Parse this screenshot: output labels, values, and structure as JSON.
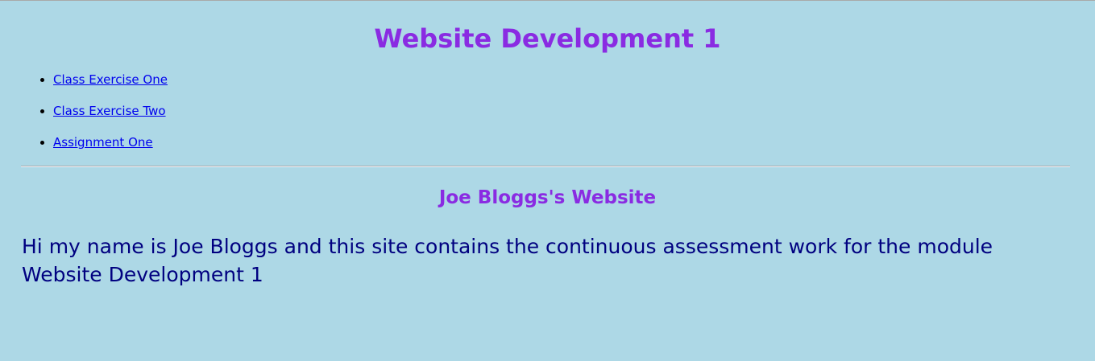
{
  "header": {
    "title": "Website Development 1"
  },
  "nav": {
    "items": [
      {
        "label": "Class Exercise One"
      },
      {
        "label": "Class Exercise Two"
      },
      {
        "label": "Assignment One"
      }
    ]
  },
  "content": {
    "heading": "Joe Bloggs's Website",
    "paragraph": "Hi my name is Joe Bloggs and this site contains the continuous assessment work for the module Website Development 1"
  },
  "colors": {
    "background": "#add8e6",
    "heading": "#8a2be2",
    "link": "#0000ee",
    "body_text": "#000080",
    "divider": "#a9a9a9"
  }
}
